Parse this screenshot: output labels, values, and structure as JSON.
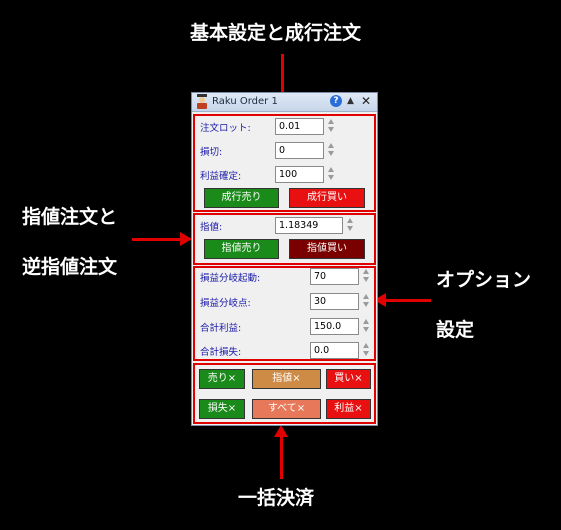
{
  "annotations": {
    "basic": "基本設定と成行注文",
    "limit1": "指値注文と",
    "limit2": "逆指値注文",
    "option1": "オプション",
    "option2": "設定",
    "bulk": "一括決済"
  },
  "window": {
    "title": "Raku Order 1",
    "help": "?",
    "up": "▲",
    "close": "✕"
  },
  "basic": {
    "lot_label": "注文ロット:",
    "lot_value": "0.01",
    "stop_label": "損切:",
    "stop_value": "0",
    "profit_label": "利益確定:",
    "profit_value": "100",
    "market_sell": "成行売り",
    "market_buy": "成行買い"
  },
  "limit": {
    "price_label": "指値:",
    "price_value": "1.18349",
    "limit_sell": "指値売り",
    "limit_buy": "指値買い"
  },
  "options": {
    "trail_start_label": "損益分岐起動:",
    "trail_start_value": "70",
    "trail_point_label": "損益分岐点:",
    "trail_point_value": "30",
    "total_profit_label": "合計利益:",
    "total_profit_value": "150.0",
    "total_loss_label": "合計損失:",
    "total_loss_value": "0.0"
  },
  "close_all": {
    "sell_close": "売り×",
    "limit_close": "指値×",
    "buy_close": "買い×",
    "loss_close": "損失×",
    "all_close": "すべて×",
    "profit_close": "利益×"
  },
  "colors": {
    "green": "#1a8a1a",
    "red": "#e81010",
    "dark_red": "#7a0000",
    "tan": "#cd8b45",
    "salmon": "#e8785a",
    "accent": "#e00000"
  }
}
